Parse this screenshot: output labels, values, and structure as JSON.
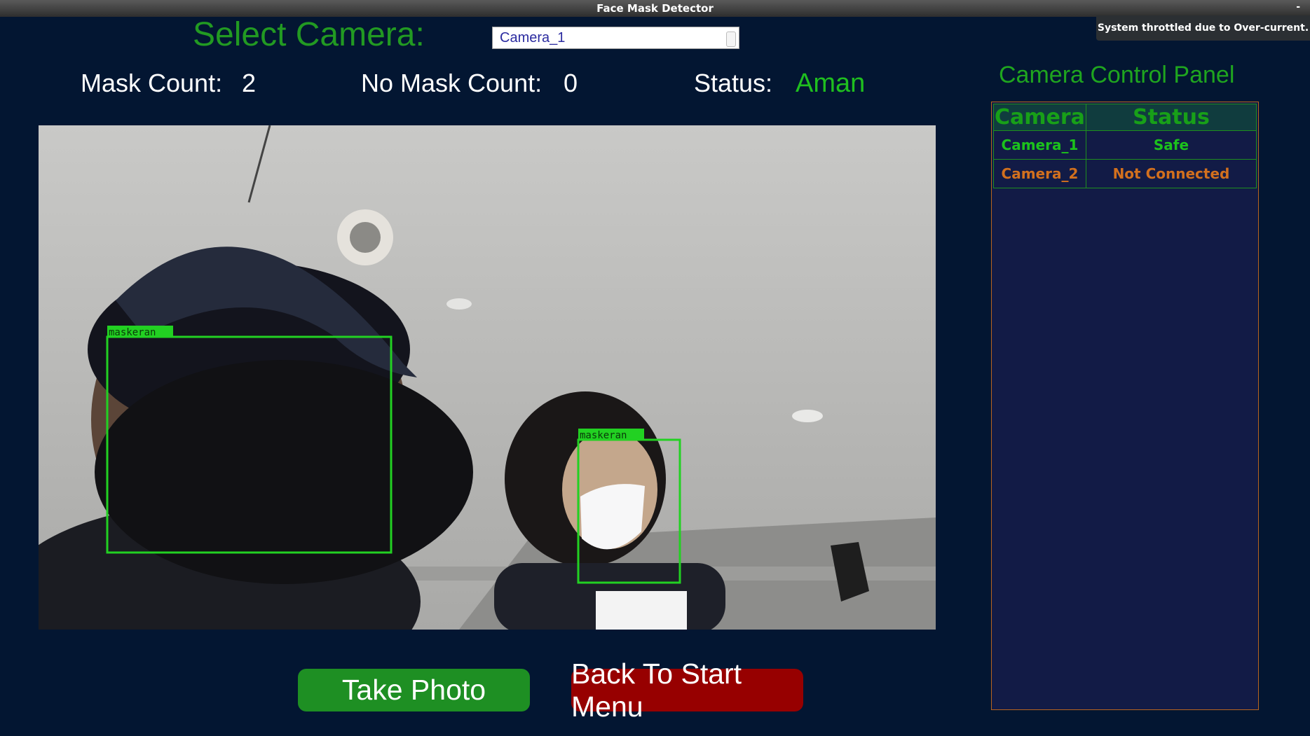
{
  "window": {
    "title": "Face Mask Detector",
    "controls": "-"
  },
  "notification": "System throttled due to Over-current.",
  "camera_select": {
    "label": "Select Camera:",
    "value": "Camera_1"
  },
  "stats": {
    "mask_label": "Mask Count:",
    "mask_value": "2",
    "no_mask_label": "No Mask Count:",
    "no_mask_value": "0",
    "status_label": "Status:",
    "status_value": "Aman"
  },
  "panel": {
    "title": "Camera Control Panel",
    "headers": [
      "Camera",
      "Status"
    ],
    "rows": [
      {
        "camera": "Camera_1",
        "status": "Safe",
        "color": "#1cc21c"
      },
      {
        "camera": "Camera_2",
        "status": "Not Connected",
        "color": "#d2701e"
      }
    ]
  },
  "feed": {
    "detections": [
      {
        "label": "maskeran"
      },
      {
        "label": "maskeran"
      }
    ]
  },
  "buttons": {
    "take_photo": "Take Photo",
    "back": "Back To Start Menu"
  },
  "colors": {
    "accent_green": "#229a22",
    "danger_red": "#970000",
    "background": "#031632"
  }
}
